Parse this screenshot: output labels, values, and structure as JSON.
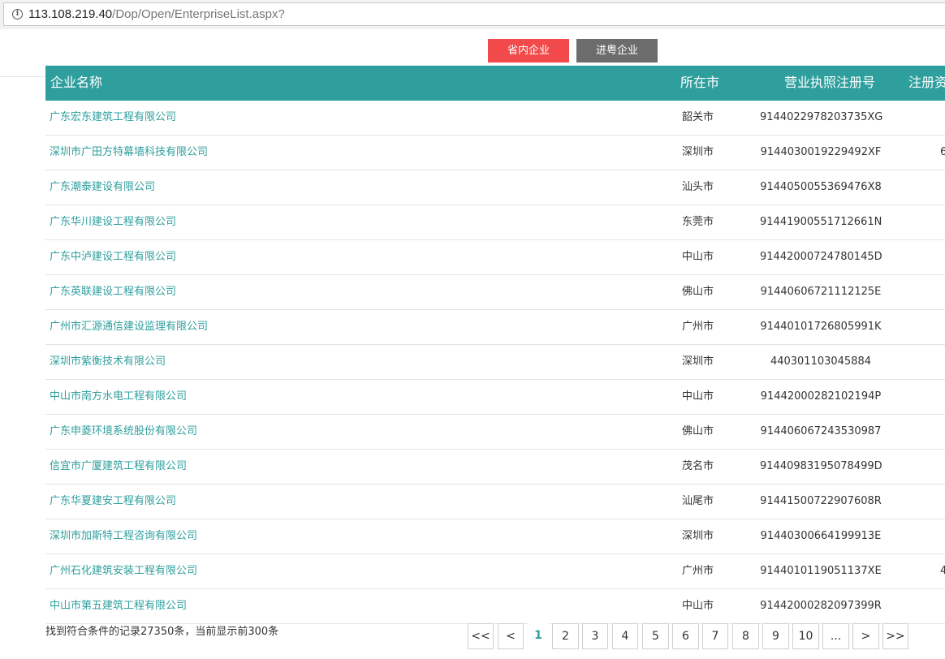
{
  "browser": {
    "url_host": "113.108.219.40",
    "url_path": "/Dop/Open/EnterpriseList.aspx?"
  },
  "tabs": {
    "province": "省内企业",
    "outside": "进粤企业"
  },
  "table": {
    "headers": {
      "name": "企业名称",
      "city": "所在市",
      "reg": "营业执照注册号",
      "capital": "注册资"
    },
    "rows": [
      {
        "name": "广东宏东建筑工程有限公司",
        "city": "韶关市",
        "reg": "9144022978203735XG",
        "capital": ""
      },
      {
        "name": "深圳市广田方特幕墙科技有限公司",
        "city": "深圳市",
        "reg": "9144030019229492XF",
        "capital": "6"
      },
      {
        "name": "广东潮泰建设有限公司",
        "city": "汕头市",
        "reg": "9144050055369476X8",
        "capital": ""
      },
      {
        "name": "广东华川建设工程有限公司",
        "city": "东莞市",
        "reg": "91441900551712661N",
        "capital": ""
      },
      {
        "name": "广东中泸建设工程有限公司",
        "city": "中山市",
        "reg": "91442000724780145D",
        "capital": ""
      },
      {
        "name": "广东英联建设工程有限公司",
        "city": "佛山市",
        "reg": "91440606721112125E",
        "capital": ""
      },
      {
        "name": "广州市汇源通信建设监理有限公司",
        "city": "广州市",
        "reg": "91440101726805991K",
        "capital": ""
      },
      {
        "name": "深圳市紫衡技术有限公司",
        "city": "深圳市",
        "reg": "440301103045884",
        "capital": ""
      },
      {
        "name": "中山市南方水电工程有限公司",
        "city": "中山市",
        "reg": "91442000282102194P",
        "capital": ""
      },
      {
        "name": "广东申菱环境系统股份有限公司",
        "city": "佛山市",
        "reg": "914406067243530987",
        "capital": ""
      },
      {
        "name": "信宜市广厦建筑工程有限公司",
        "city": "茂名市",
        "reg": "91440983195078499D",
        "capital": ""
      },
      {
        "name": "广东华夏建安工程有限公司",
        "city": "汕尾市",
        "reg": "91441500722907608R",
        "capital": ""
      },
      {
        "name": "深圳市加斯特工程咨询有限公司",
        "city": "深圳市",
        "reg": "91440300664199913E",
        "capital": ""
      },
      {
        "name": "广州石化建筑安装工程有限公司",
        "city": "广州市",
        "reg": "9144010119051137XE",
        "capital": "4"
      },
      {
        "name": "中山市第五建筑工程有限公司",
        "city": "中山市",
        "reg": "91442000282097399R",
        "capital": ""
      }
    ]
  },
  "footer": {
    "summary": "找到符合条件的记录27350条，当前显示前300条"
  },
  "pager": {
    "buttons": [
      {
        "label": "<<",
        "name": "pager-first-button",
        "current": false
      },
      {
        "label": "<",
        "name": "pager-prev-button",
        "current": false
      },
      {
        "label": "1",
        "name": "pager-page-1",
        "current": true
      },
      {
        "label": "2",
        "name": "pager-page-2",
        "current": false
      },
      {
        "label": "3",
        "name": "pager-page-3",
        "current": false
      },
      {
        "label": "4",
        "name": "pager-page-4",
        "current": false
      },
      {
        "label": "5",
        "name": "pager-page-5",
        "current": false
      },
      {
        "label": "6",
        "name": "pager-page-6",
        "current": false
      },
      {
        "label": "7",
        "name": "pager-page-7",
        "current": false
      },
      {
        "label": "8",
        "name": "pager-page-8",
        "current": false
      },
      {
        "label": "9",
        "name": "pager-page-9",
        "current": false
      },
      {
        "label": "10",
        "name": "pager-page-10",
        "current": false
      },
      {
        "label": "...",
        "name": "pager-ellipsis-button",
        "current": false
      },
      {
        "label": ">",
        "name": "pager-next-button",
        "current": false
      },
      {
        "label": ">>",
        "name": "pager-last-button",
        "current": false
      }
    ]
  }
}
